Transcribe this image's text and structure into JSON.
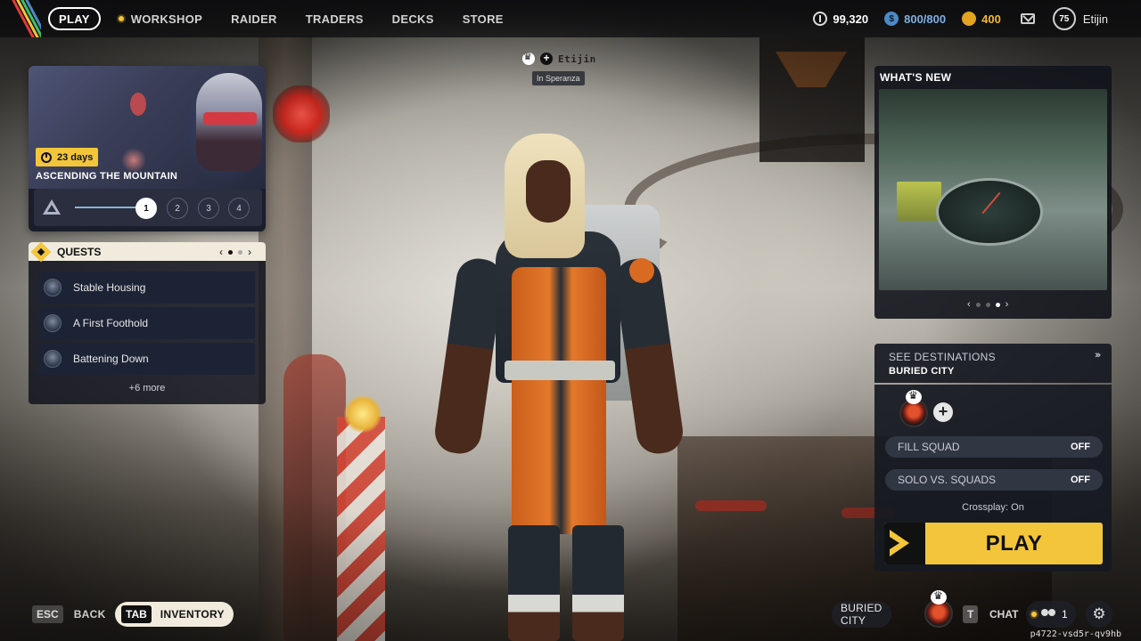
{
  "topbar": {
    "nav": {
      "play": "PLAY",
      "workshop": "WORKSHOP",
      "raider": "RAIDER",
      "traders": "TRADERS",
      "decks": "DECKS",
      "store": "STORE"
    },
    "currencies": {
      "coins": "99,320",
      "blue": "800/800",
      "gold": "400"
    },
    "level": "75",
    "username": "Etijin"
  },
  "nametag": {
    "name": "Etijin",
    "location": "In Speranza"
  },
  "event": {
    "timer": "23  days",
    "title": "ASCENDING THE MOUNTAIN",
    "steps": [
      "1",
      "2",
      "3",
      "4"
    ],
    "current_step": 1
  },
  "quests": {
    "title": "QUESTS",
    "items": [
      {
        "name": "Stable Housing"
      },
      {
        "name": "A First Foothold"
      },
      {
        "name": "Battening Down"
      }
    ],
    "more": "+6 more"
  },
  "whats_new": {
    "title": "WHAT'S NEW",
    "page": 3,
    "pages": 3
  },
  "play_panel": {
    "see_destinations": "SEE DESTINATIONS",
    "destination": "BURIED CITY",
    "fill_squad_label": "FILL SQUAD",
    "fill_squad_value": "OFF",
    "solo_label": "SOLO VS. SQUADS",
    "solo_value": "OFF",
    "crossplay": "Crossplay: On",
    "play_label": "PLAY"
  },
  "bottom": {
    "back_key": "ESC",
    "back_label": "BACK",
    "inventory_key": "TAB",
    "inventory_label": "INVENTORY",
    "city_chip": "BURIED CITY",
    "chat_key": "T",
    "chat_label": "CHAT",
    "friends_count": "1",
    "build_id": "p4722-vsd5r-qv9hb"
  },
  "colors": {
    "accent_yellow": "#f3c53b",
    "panel_dark": "#16191f",
    "currency_blue": "#7fb0e2",
    "currency_gold": "#f1b836"
  }
}
